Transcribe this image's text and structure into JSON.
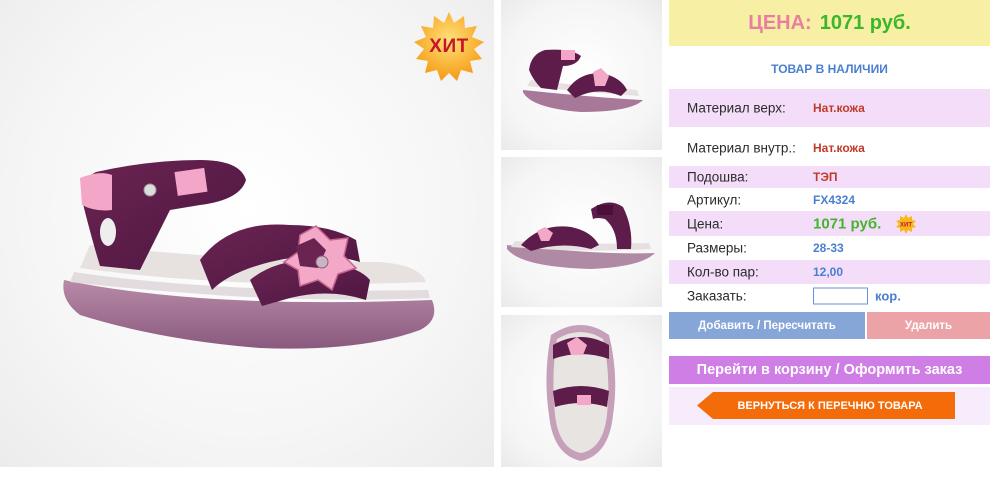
{
  "badge": {
    "hit_label": "ХИТ"
  },
  "price_header": {
    "label": "ЦЕНА:",
    "value": "1071 руб."
  },
  "stock_status": "ТОВАР В НАЛИЧИИ",
  "specs": [
    {
      "key": "Материал верх:",
      "value": "Нат.кожа"
    },
    {
      "key": "Материал внутр.:",
      "value": "Нат.кожа"
    },
    {
      "key": "Подошва:",
      "value": "ТЭП"
    },
    {
      "key": "Артикул:",
      "value": "FX4324"
    },
    {
      "key": "Цена:",
      "value": "1071 руб."
    },
    {
      "key": "Размеры:",
      "value": "28-33"
    },
    {
      "key": "Кол-во пар:",
      "value": "12,00"
    }
  ],
  "order": {
    "label": "Заказать:",
    "quantity_value": "",
    "unit": "кор."
  },
  "buttons": {
    "add": "Добавить / Пересчитать",
    "delete": "Удалить",
    "cart": "Перейти в корзину / Оформить заказ",
    "back": "ВЕРНУТЬСЯ К ПЕРЕЧНЮ ТОВАРА"
  },
  "colors": {
    "price_bg": "#f7efa4",
    "row_pink": "#f4ddf9",
    "accent_blue": "#4a7fd0",
    "price_green": "#3cb62c",
    "cart_purple": "#cf7ee6",
    "back_orange": "#f46b0a"
  },
  "icons": [
    "hit-badge-icon",
    "sandal-photo",
    "sandal-thumb"
  ]
}
